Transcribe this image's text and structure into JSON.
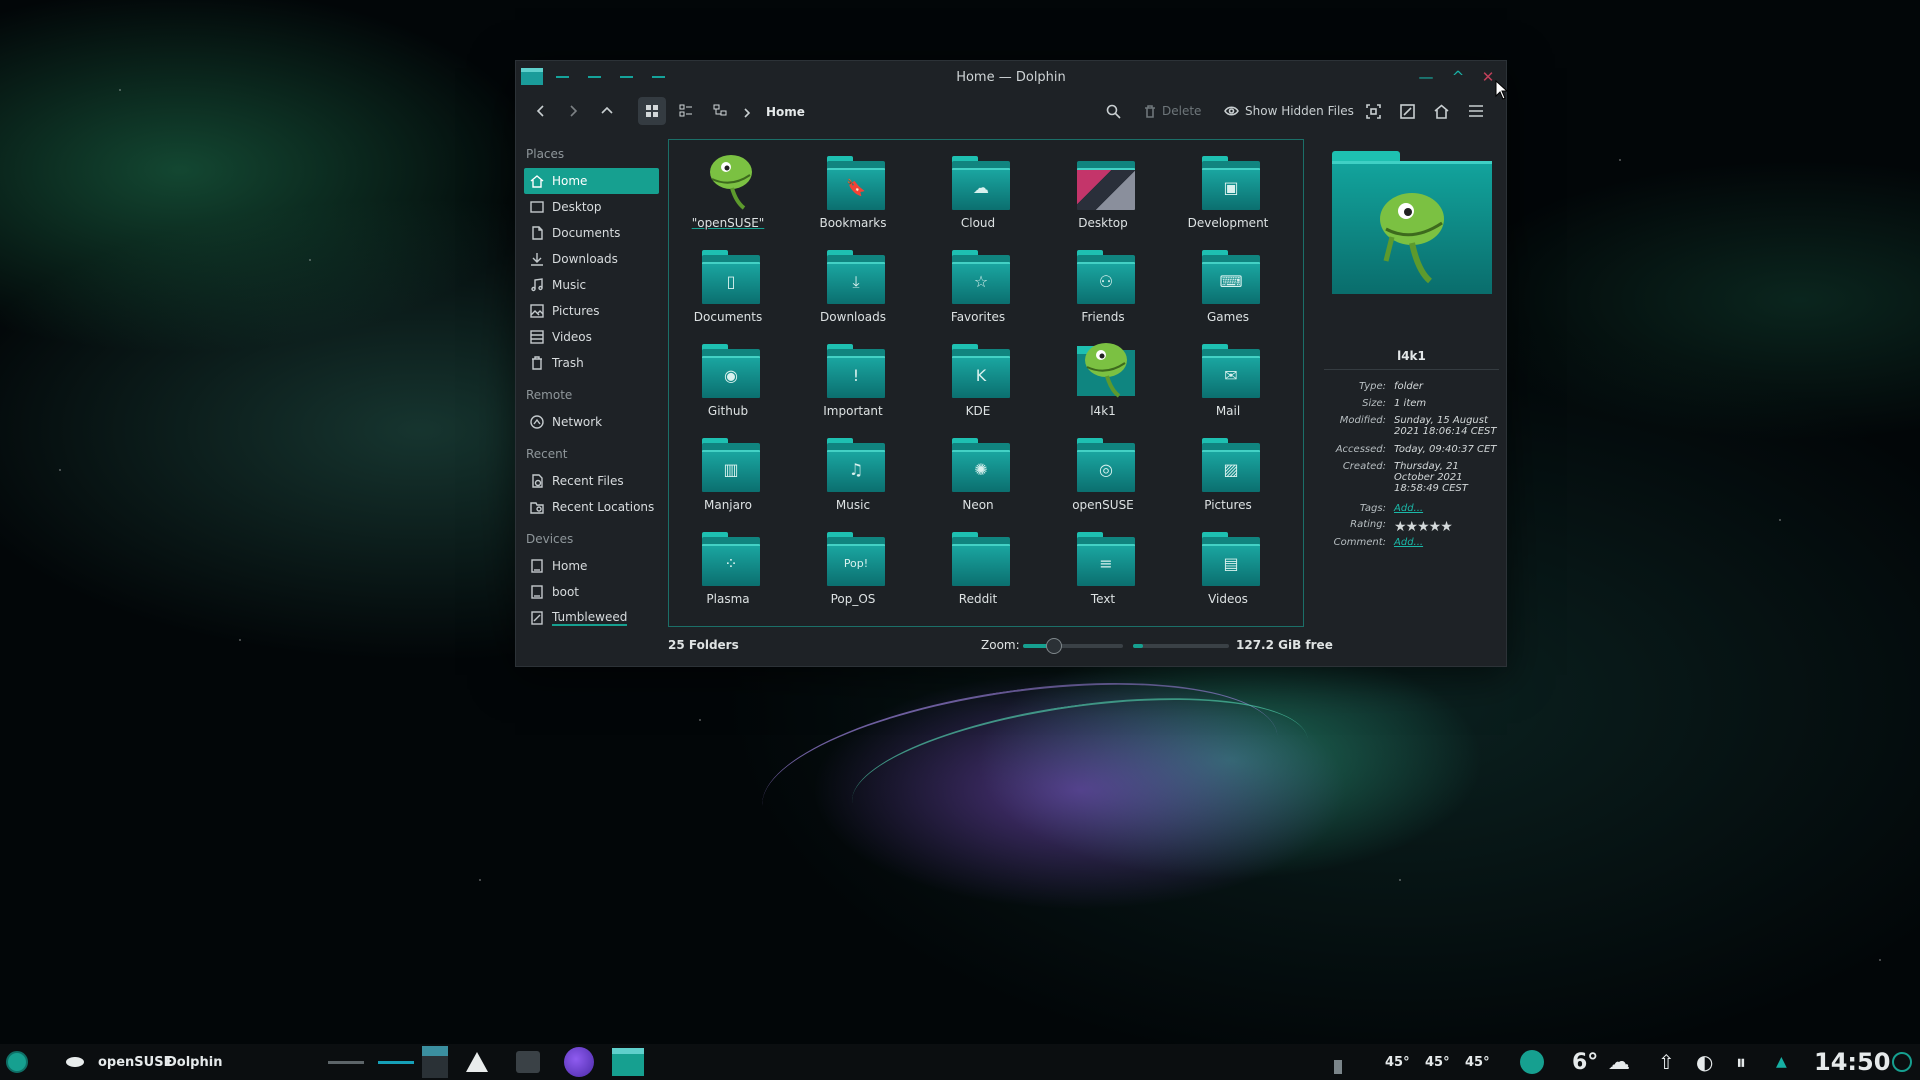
{
  "window": {
    "title": "Home — Dolphin"
  },
  "toolbar": {
    "breadcrumb": "Home",
    "delete_label": "Delete",
    "show_hidden_label": "Show Hidden Files"
  },
  "sidebar": {
    "places_header": "Places",
    "places": [
      {
        "label": "Home",
        "icon": "home-icon"
      },
      {
        "label": "Desktop",
        "icon": "desktop-icon"
      },
      {
        "label": "Documents",
        "icon": "documents-icon"
      },
      {
        "label": "Downloads",
        "icon": "downloads-icon"
      },
      {
        "label": "Music",
        "icon": "music-icon"
      },
      {
        "label": "Pictures",
        "icon": "pictures-icon"
      },
      {
        "label": "Videos",
        "icon": "videos-icon"
      },
      {
        "label": "Trash",
        "icon": "trash-icon"
      }
    ],
    "remote_header": "Remote",
    "remote": [
      {
        "label": "Network",
        "icon": "network-icon"
      }
    ],
    "recent_header": "Recent",
    "recent": [
      {
        "label": "Recent Files",
        "icon": "recent-files-icon"
      },
      {
        "label": "Recent Locations",
        "icon": "recent-locations-icon"
      }
    ],
    "devices_header": "Devices",
    "devices": [
      {
        "label": "Home",
        "icon": "drive-icon"
      },
      {
        "label": "boot",
        "icon": "drive-icon"
      },
      {
        "label": "Tumbleweed",
        "icon": "drive-icon"
      }
    ]
  },
  "files": [
    {
      "name": "\"openSUSE\"",
      "icon": "chameleon-icon"
    },
    {
      "name": "Bookmarks",
      "icon": "bookmark-icon"
    },
    {
      "name": "Cloud",
      "icon": "cloud-icon"
    },
    {
      "name": "Desktop",
      "icon": "desktop-folder-icon"
    },
    {
      "name": "Development",
      "icon": "development-icon"
    },
    {
      "name": "Documents",
      "icon": "document-icon"
    },
    {
      "name": "Downloads",
      "icon": "download-icon"
    },
    {
      "name": "Favorites",
      "icon": "star-icon"
    },
    {
      "name": "Friends",
      "icon": "people-icon"
    },
    {
      "name": "Games",
      "icon": "gamepad-icon"
    },
    {
      "name": "Github",
      "icon": "github-icon"
    },
    {
      "name": "Important",
      "icon": "exclamation-icon"
    },
    {
      "name": "KDE",
      "icon": "kde-icon"
    },
    {
      "name": "l4k1",
      "icon": "chameleon-icon"
    },
    {
      "name": "Mail",
      "icon": "mail-icon"
    },
    {
      "name": "Manjaro",
      "icon": "manjaro-icon"
    },
    {
      "name": "Music",
      "icon": "music-note-icon"
    },
    {
      "name": "Neon",
      "icon": "neon-icon"
    },
    {
      "name": "openSUSE",
      "icon": "opensuse-icon"
    },
    {
      "name": "Pictures",
      "icon": "picture-icon"
    },
    {
      "name": "Plasma",
      "icon": "plasma-icon"
    },
    {
      "name": "Pop_OS",
      "icon": "popos-icon"
    },
    {
      "name": "Reddit",
      "icon": "reddit-icon"
    },
    {
      "name": "Text",
      "icon": "text-icon"
    },
    {
      "name": "Videos",
      "icon": "film-icon"
    }
  ],
  "details": {
    "name": "l4k1",
    "rows": [
      {
        "key": "Type:",
        "value": "folder"
      },
      {
        "key": "Size:",
        "value": "1 item"
      },
      {
        "key": "Modified:",
        "value": "Sunday, 15 August 2021 18:06:14 CEST"
      },
      {
        "key": "Accessed:",
        "value": "Today, 09:40:37 CET"
      },
      {
        "key": "Created:",
        "value": "Thursday, 21 October 2021 18:58:49 CEST"
      },
      {
        "key": "Tags:",
        "value": "Add..."
      },
      {
        "key": "Rating:",
        "value": "★★★★★"
      },
      {
        "key": "Comment:",
        "value": "Add..."
      }
    ],
    "rating": 5
  },
  "status": {
    "count": "25 Folders",
    "zoom_label": "Zoom:",
    "free_space": "127.2 GiB free",
    "zoom_level": 0.3,
    "disk_used_fraction": 0.1
  },
  "taskbar": {
    "start_label": "openSUSE",
    "active_app": "Dolphin",
    "temps": [
      "45°",
      "45°",
      "45°"
    ],
    "weather_temp": "6°",
    "clock": "14:50"
  },
  "colors": {
    "accent": "#16a090",
    "folder": "#10847f",
    "window_bg": "#1e2226"
  }
}
